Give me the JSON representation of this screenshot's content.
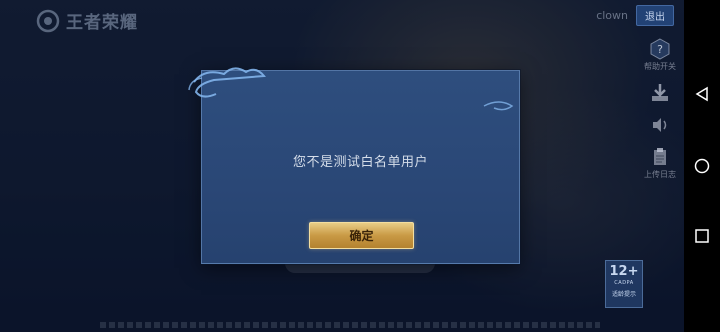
{
  "app": {
    "logo_text": "王者荣耀"
  },
  "account": {
    "username": "clown",
    "logout_label": "退出"
  },
  "side_menu": [
    {
      "icon": "help-icon",
      "label": "帮助开关"
    },
    {
      "icon": "download-icon",
      "label": ""
    },
    {
      "icon": "volume-icon",
      "label": ""
    },
    {
      "icon": "clipboard-icon",
      "label": "上传日志"
    }
  ],
  "age_rating": {
    "age": "12+",
    "org": "CADPA",
    "tip": "适龄提示"
  },
  "dialog": {
    "message": "您不是测试白名单用户",
    "confirm_label": "确定"
  },
  "system_nav": {
    "back": "back-icon",
    "home": "home-icon",
    "recents": "recents-icon"
  },
  "colors": {
    "dialog_bg": "#2e4e7e",
    "button_gold": "#c99a45",
    "nav_bg": "#000000"
  }
}
